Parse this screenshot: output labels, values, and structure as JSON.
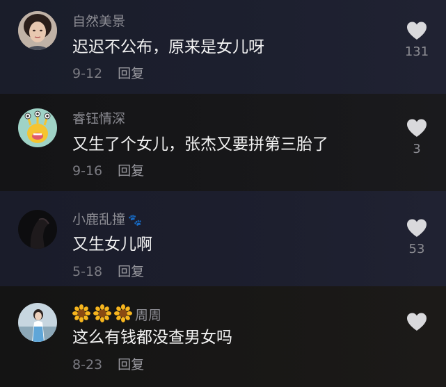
{
  "comments": [
    {
      "username": "自然美景",
      "text": "迟迟不公布，原来是女儿呀",
      "date": "9-12",
      "reply_label": "回复",
      "like_count": "131",
      "avatar": "woman-portrait-avatar"
    },
    {
      "username": "睿钰情深",
      "text": "又生了个女儿，张杰又要拼第三胎了",
      "date": "9-16",
      "reply_label": "回复",
      "like_count": "3",
      "avatar": "green-cartoon-monster-avatar"
    },
    {
      "username": "小鹿乱撞",
      "username_emoji": "🐾",
      "text": "又生女儿啊",
      "date": "5-18",
      "reply_label": "回复",
      "like_count": "53",
      "avatar": "dark-silhouette-avatar"
    },
    {
      "username": "周周",
      "username_prefix_icons": [
        "sunflower-icon",
        "sunflower-icon",
        "sunflower-icon"
      ],
      "text": "这么有钱都没查男女吗",
      "date": "8-23",
      "reply_label": "回复",
      "like_count": "",
      "avatar": "woman-outdoor-avatar"
    }
  ],
  "colors": {
    "username": "#8c8c93",
    "text": "#f2f2f2",
    "meta": "#7b7b82",
    "heart": "#d9d9dc"
  }
}
